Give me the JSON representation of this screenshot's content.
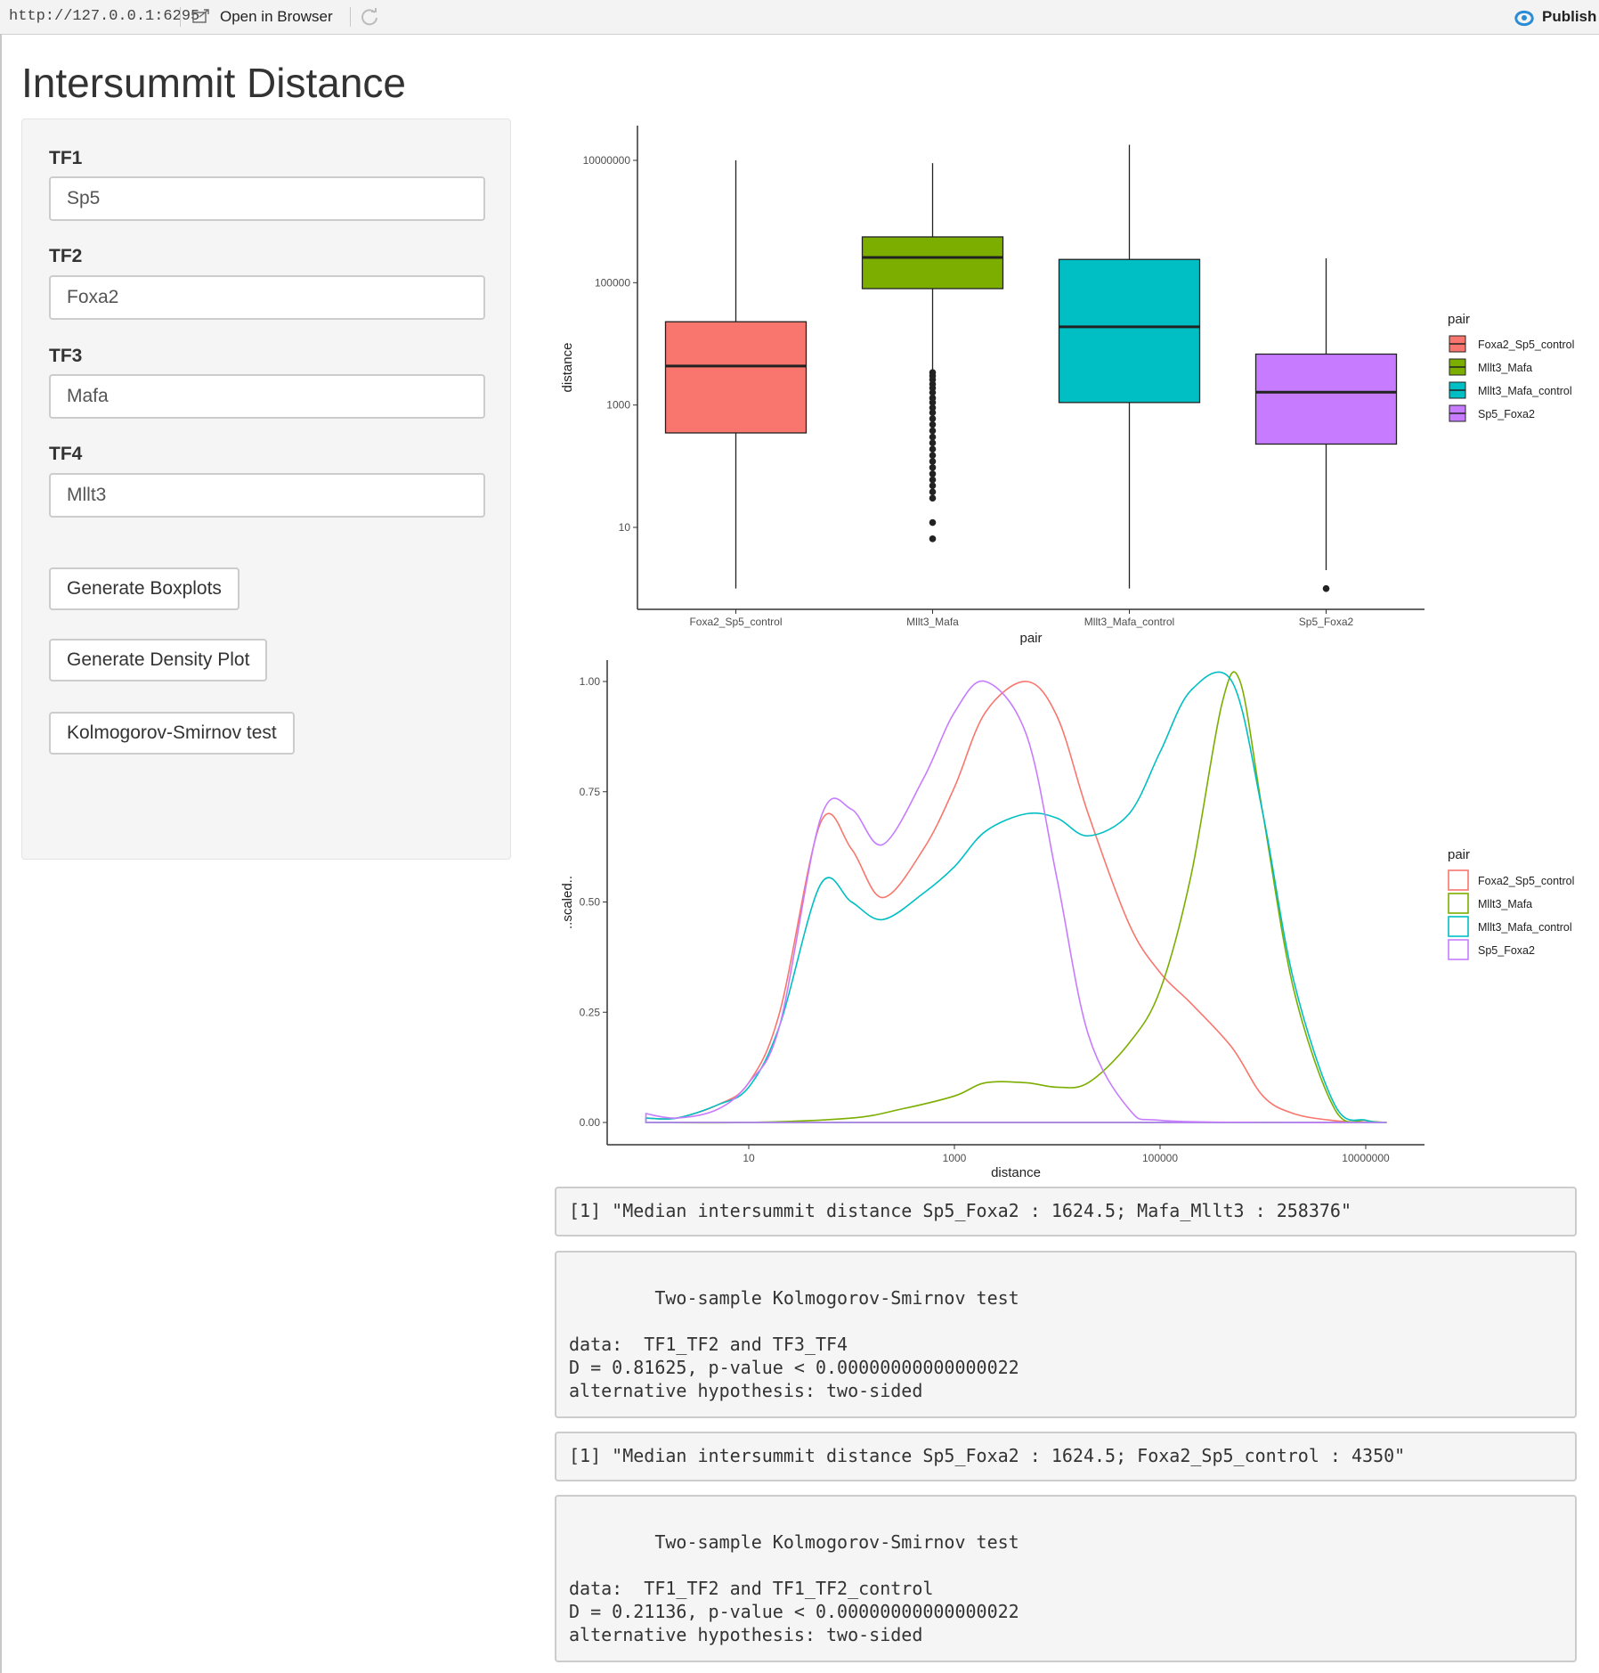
{
  "topbar": {
    "url": "http://127.0.0.1:6295",
    "open_label": "Open in Browser",
    "publish_label": "Publish"
  },
  "page": {
    "title": "Intersummit Distance"
  },
  "sidebar": {
    "fields": [
      {
        "label": "TF1",
        "value": "Sp5"
      },
      {
        "label": "TF2",
        "value": "Foxa2"
      },
      {
        "label": "TF3",
        "value": "Mafa"
      },
      {
        "label": "TF4",
        "value": "Mllt3"
      }
    ],
    "buttons": [
      {
        "label": "Generate Boxplots"
      },
      {
        "label": "Generate Density Plot"
      },
      {
        "label": "Kolmogorov-Smirnov test"
      }
    ]
  },
  "colors": {
    "Foxa2_Sp5_control": "#F8766D",
    "Mllt3_Mafa": "#7CAE00",
    "Mllt3_Mafa_control": "#00BFC4",
    "Sp5_Foxa2": "#C77CFF"
  },
  "chart_data": [
    {
      "type": "box",
      "xlabel": "pair",
      "ylabel": "distance",
      "y_scale": "log10",
      "y_ticks": [
        "10",
        "1000",
        "100000",
        "10000000"
      ],
      "legend_title": "pair",
      "legend_position": "right",
      "categories": [
        "Foxa2_Sp5_control",
        "Mllt3_Mafa",
        "Mllt3_Mafa_control",
        "Sp5_Foxa2"
      ],
      "boxes": [
        {
          "name": "Foxa2_Sp5_control",
          "min": 1,
          "q1": 350,
          "median": 4350,
          "q3": 23000,
          "max": 10000000,
          "outliers": []
        },
        {
          "name": "Mllt3_Mafa",
          "min": 3500,
          "q1": 80000,
          "median": 258376,
          "q3": 560000,
          "max": 9000000,
          "outliers": [
            3400,
            3000,
            2600,
            2200,
            1900,
            1600,
            1300,
            1100,
            900,
            750,
            600,
            480,
            380,
            300,
            240,
            190,
            150,
            120,
            95,
            75,
            60,
            48,
            38,
            30,
            12,
            6.5
          ]
        },
        {
          "name": "Mllt3_Mafa_control",
          "min": 1,
          "q1": 1100,
          "median": 19000,
          "q3": 240000,
          "max": 18000000,
          "outliers": []
        },
        {
          "name": "Sp5_Foxa2",
          "min": 2,
          "q1": 230,
          "median": 1624.5,
          "q3": 6800,
          "max": 250000,
          "outliers": [
            1
          ]
        }
      ]
    },
    {
      "type": "line",
      "xlabel": "distance",
      "ylabel": "..scaled..",
      "x_scale": "log10",
      "x_ticks": [
        "10",
        "1000",
        "100000",
        "10000000"
      ],
      "y_ticks": [
        "0.00",
        "0.25",
        "0.50",
        "0.75",
        "1.00"
      ],
      "legend_title": "pair",
      "legend_position": "right",
      "series": [
        {
          "name": "Foxa2_Sp5_control",
          "x": [
            1,
            2,
            5,
            10,
            20,
            50,
            100,
            200,
            500,
            1000,
            2000,
            5000,
            10000,
            20000,
            50000,
            100000,
            200000,
            500000,
            1000000,
            2000000,
            5000000,
            10000000,
            16000000
          ],
          "y": [
            0.01,
            0.01,
            0.04,
            0.09,
            0.25,
            0.68,
            0.62,
            0.51,
            0.62,
            0.76,
            0.93,
            1.0,
            0.92,
            0.7,
            0.45,
            0.34,
            0.27,
            0.17,
            0.06,
            0.02,
            0.004,
            0.001,
            0.0
          ]
        },
        {
          "name": "Mllt3_Mafa",
          "x": [
            1,
            10,
            100,
            300,
            1000,
            2000,
            5000,
            10000,
            20000,
            50000,
            100000,
            200000,
            400000,
            600000,
            1000000,
            2000000,
            5000000,
            10000000,
            16000000
          ],
          "y": [
            0.0,
            0.0,
            0.01,
            0.03,
            0.06,
            0.09,
            0.09,
            0.08,
            0.09,
            0.18,
            0.3,
            0.56,
            0.95,
            1.0,
            0.7,
            0.3,
            0.03,
            0.005,
            0.0
          ]
        },
        {
          "name": "Mllt3_Mafa_control",
          "x": [
            1,
            2,
            5,
            10,
            20,
            50,
            100,
            200,
            500,
            1000,
            2000,
            5000,
            10000,
            20000,
            50000,
            100000,
            200000,
            500000,
            1000000,
            2000000,
            5000000,
            10000000,
            16000000
          ],
          "y": [
            0.01,
            0.01,
            0.04,
            0.08,
            0.22,
            0.54,
            0.5,
            0.46,
            0.52,
            0.58,
            0.66,
            0.7,
            0.69,
            0.65,
            0.7,
            0.84,
            0.98,
            1.0,
            0.7,
            0.32,
            0.04,
            0.005,
            0.0
          ]
        },
        {
          "name": "Sp5_Foxa2",
          "x": [
            1,
            2,
            5,
            10,
            20,
            50,
            100,
            200,
            500,
            1000,
            2000,
            5000,
            10000,
            20000,
            50000,
            100000,
            1000000,
            16000000
          ],
          "y": [
            0.02,
            0.01,
            0.03,
            0.09,
            0.22,
            0.69,
            0.71,
            0.63,
            0.78,
            0.93,
            1.0,
            0.88,
            0.55,
            0.2,
            0.03,
            0.005,
            0.0,
            0.0
          ]
        }
      ]
    }
  ],
  "outputs": [
    {
      "text": "[1] \"Median intersummit distance Sp5_Foxa2 : 1624.5; Mafa_Mllt3 : 258376\""
    },
    {
      "text": "\n\tTwo-sample Kolmogorov-Smirnov test\n\ndata:  TF1_TF2 and TF3_TF4\nD = 0.81625, p-value < 0.00000000000000022\nalternative hypothesis: two-sided"
    },
    {
      "text": "[1] \"Median intersummit distance Sp5_Foxa2 : 1624.5; Foxa2_Sp5_control : 4350\""
    },
    {
      "text": "\n\tTwo-sample Kolmogorov-Smirnov test\n\ndata:  TF1_TF2 and TF1_TF2_control\nD = 0.21136, p-value < 0.00000000000000022\nalternative hypothesis: two-sided"
    }
  ]
}
